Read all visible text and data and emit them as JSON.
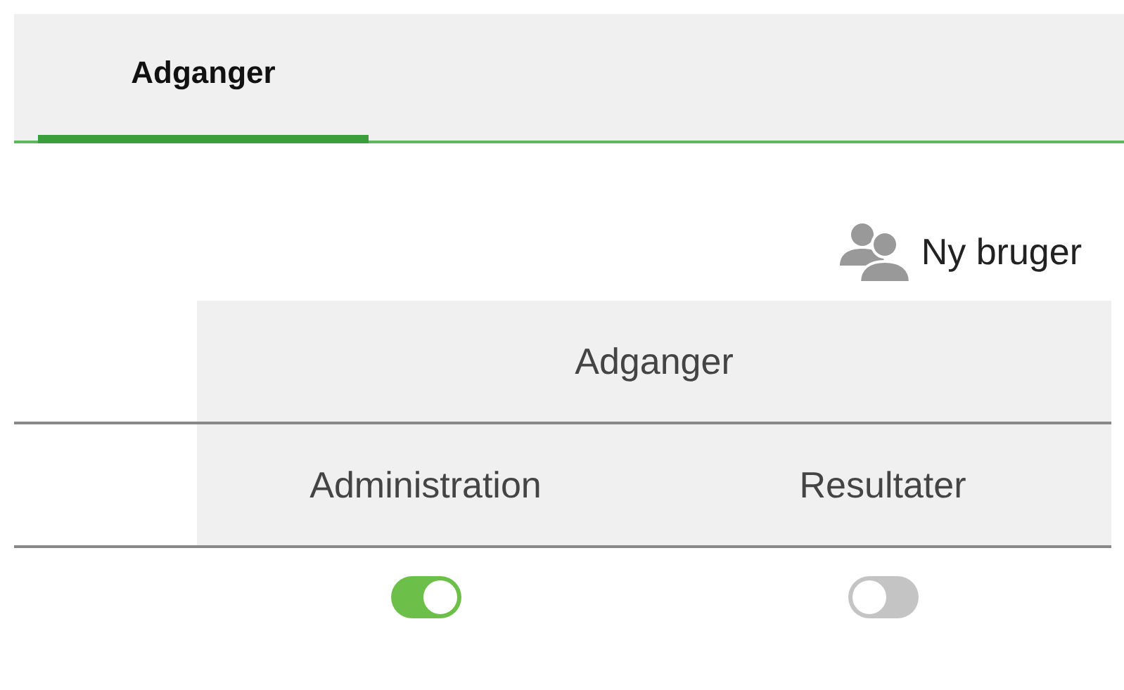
{
  "tabs": [
    {
      "label": "Adganger",
      "selected": true
    }
  ],
  "new_user_button": {
    "label": "Ny bruger"
  },
  "table": {
    "group_header": "Adganger",
    "columns": [
      "Administration",
      "Resultater"
    ],
    "rows": [
      {
        "toggles": [
          {
            "on": true
          },
          {
            "on": false
          }
        ]
      }
    ]
  }
}
